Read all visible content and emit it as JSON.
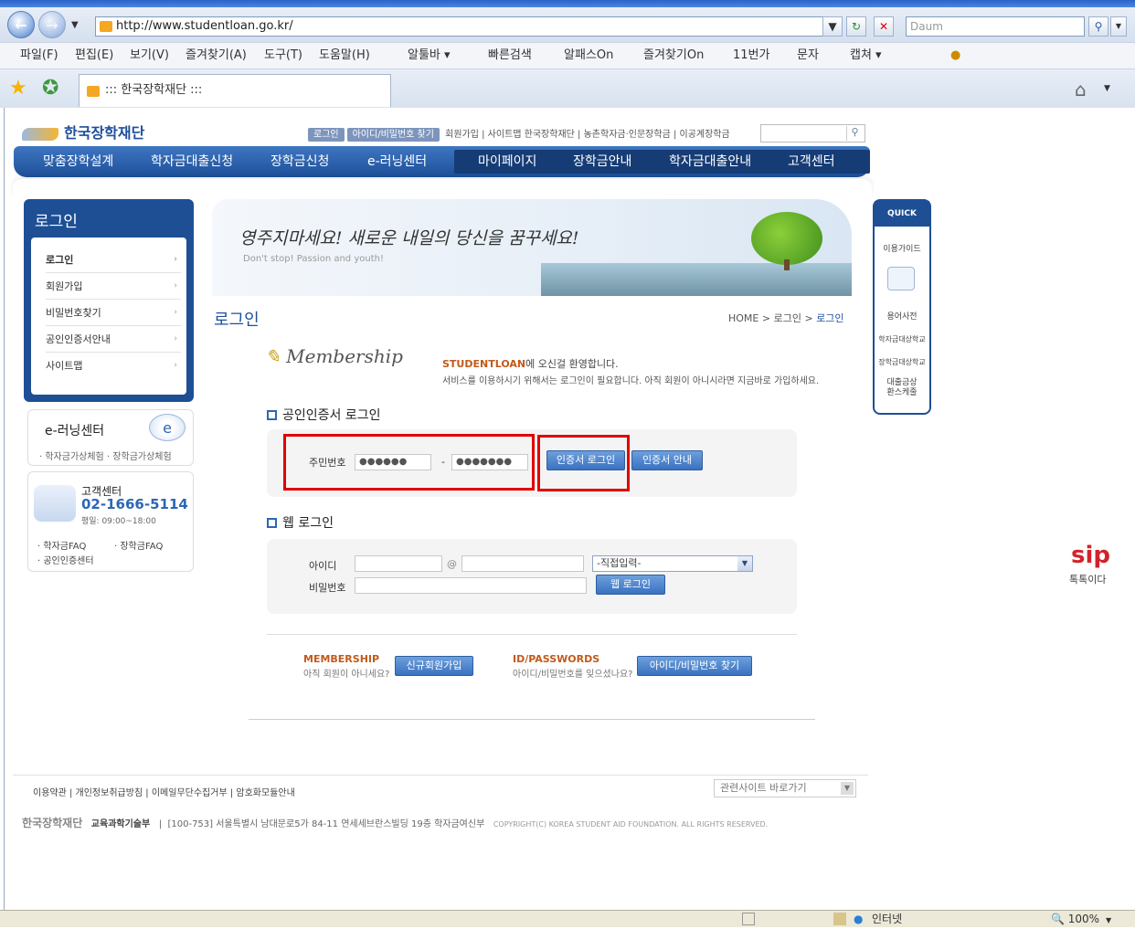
{
  "browser": {
    "url": "http://www.studentloan.go.kr/",
    "search_placeholder": "Daum",
    "menu": [
      "파일(F)",
      "편집(E)",
      "보기(V)",
      "즐겨찾기(A)",
      "도구(T)",
      "도움말(H)"
    ],
    "toolbar": [
      "알툴바 ▾",
      "빠른검색",
      "알패스On",
      "즐겨찾기On",
      "11번가",
      "문자",
      "캡쳐 ▾"
    ],
    "tab_title": "::: 한국장학재단 :::",
    "status_zone": "인터넷",
    "zoom": "100%"
  },
  "site": {
    "logo": "한국장학재단",
    "util_buttons": [
      "로그인",
      "아이디/비밀번호 찾기"
    ],
    "util_links": "회원가입 | 사이트맵  한국장학재단 | 농촌학자금·인문장학금 | 이공계장학금",
    "gnb": [
      "맞춤장학설계",
      "학자금대출신청",
      "장학금신청",
      "e-러닝센터",
      "마이페이지",
      "장학금안내",
      "학자금대출안내",
      "고객센터"
    ],
    "lnb": {
      "title": "로그인",
      "items": [
        "로그인",
        "회원가입",
        "비밀번호찾기",
        "공인인증서안내",
        "사이트맵"
      ]
    },
    "elearning": {
      "title": "e-러닝센터",
      "links": "· 학자금가상체험 · 장학금가상체험"
    },
    "customer": {
      "title": "고객센터",
      "phone": "02-1666-5114",
      "hours": "평일: 09:00~18:00",
      "links": [
        "학자금FAQ",
        "장학금FAQ",
        "공인인증센터"
      ]
    },
    "banner": {
      "slogan": "영주지마세요! 새로운 내일의 당신을 꿈꾸세요!",
      "sub": "Don't stop! Passion and youth!"
    },
    "page_title": "로그인",
    "breadcrumb": {
      "home": "HOME",
      "sep": ">",
      "mid": "로그인",
      "current": "로그인"
    },
    "membership": {
      "title": "Membership",
      "welcome_strong": "STUDENTLOAN",
      "welcome_rest": "에 오신걸 환영합니다.",
      "welcome_sub": "서비스를 이용하시기 위해서는 로그인이 필요합니다. 아직 회원이 아니시라면 지금바로 가입하세요."
    },
    "cert_login": {
      "heading": "공인인증서 로그인",
      "label": "주민번호",
      "rrn_front": "●●●●●●",
      "dash": "-",
      "rrn_back": "●●●●●●●",
      "login_button": "인증서 로그인",
      "guide_button": "인증서 안내"
    },
    "web_login": {
      "heading": "웹 로그인",
      "id_label": "아이디",
      "at": "@",
      "pw_label": "비밀번호",
      "domain_select": "-직접입력-",
      "login_button": "웹 로그인"
    },
    "join": {
      "title": "MEMBERSHIP",
      "text": "아직 회원이 아니세요?",
      "button": "신규회원가입"
    },
    "find": {
      "title": "ID/PASSWORDS",
      "text": "아이디/비밀번호를 잊으셨나요?",
      "button": "아이디/비밀번호 찾기"
    },
    "quick_menu": {
      "title": "QUICK MENU",
      "items": [
        "이용가이드",
        "용어사전",
        "학자금대상학교",
        "장학금대상학교",
        "대출금상환스케줄"
      ]
    },
    "footer": {
      "links": "이용약관  |  개인정보취급방침  |  이메일무단수집거부  |  암호화모듈안내",
      "related": "관련사이트 바로가기",
      "org1": "한국장학재단",
      "org2": "교육과학기술부",
      "address": "[100-753] 서울특별시 남대문로5가 84-11 연세세브란스빌딩 19층  학자금여신부",
      "copyright": "COPYRIGHT(C) KOREA STUDENT AID FOUNDATION. ALL RIGHTS RESERVED."
    },
    "side_ad": {
      "brand": "sip",
      "text": "톡톡이다"
    }
  }
}
